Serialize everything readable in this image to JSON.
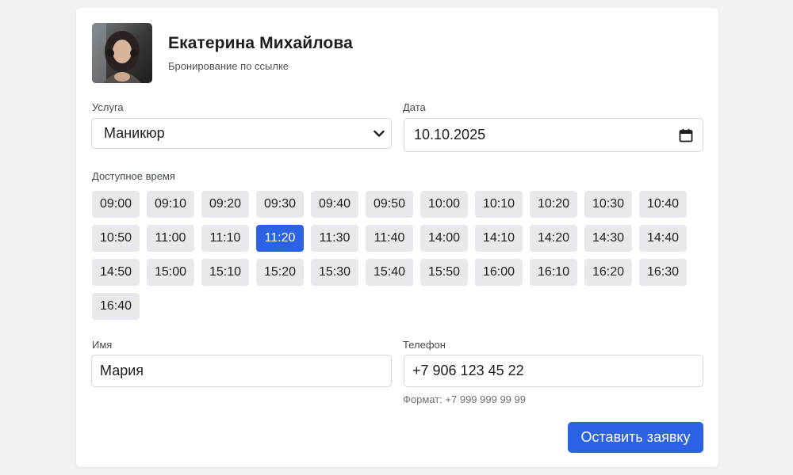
{
  "profile": {
    "name": "Екатерина Михайлова",
    "subtitle": "Бронирование по ссылке"
  },
  "service": {
    "label": "Услуга",
    "selected": "Маникюр"
  },
  "date": {
    "label": "Дата",
    "value": "10.10.2025"
  },
  "time": {
    "label": "Доступное время",
    "slots": [
      "09:00",
      "09:10",
      "09:20",
      "09:30",
      "09:40",
      "09:50",
      "10:00",
      "10:10",
      "10:20",
      "10:30",
      "10:40",
      "10:50",
      "11:00",
      "11:10",
      "11:20",
      "11:30",
      "11:40",
      "14:00",
      "14:10",
      "14:20",
      "14:30",
      "14:40",
      "14:50",
      "15:00",
      "15:10",
      "15:20",
      "15:30",
      "15:40",
      "15:50",
      "16:00",
      "16:10",
      "16:20",
      "16:30",
      "16:40"
    ],
    "selected": "11:20"
  },
  "name_field": {
    "label": "Имя",
    "value": "Мария"
  },
  "phone_field": {
    "label": "Телефон",
    "value": "+7 906 123 45 22",
    "hint": "Формат: +7 999 999 99 99"
  },
  "submit_label": "Оставить заявку",
  "colors": {
    "accent": "#2b63e4",
    "slot_bg": "#e8e9ec"
  },
  "icons": {
    "avatar": "avatar-photo",
    "service_dropdown": "chevron-down-icon",
    "date_picker": "calendar-icon"
  }
}
